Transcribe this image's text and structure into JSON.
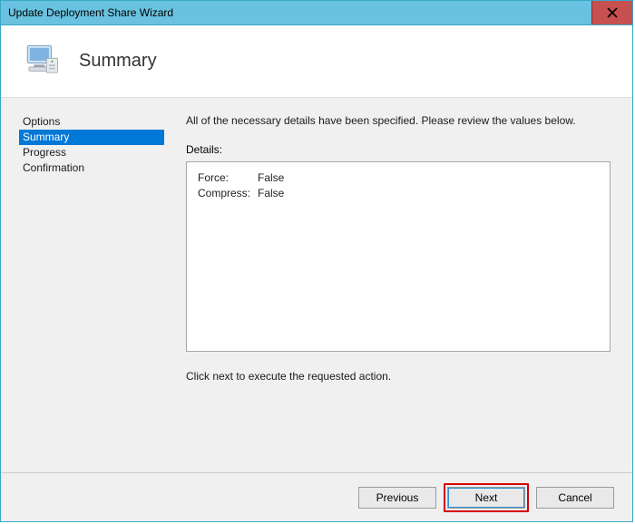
{
  "window": {
    "title": "Update Deployment Share Wizard"
  },
  "header": {
    "page_title": "Summary"
  },
  "sidebar": {
    "steps": {
      "0": {
        "label": "Options"
      },
      "1": {
        "label": "Summary"
      },
      "2": {
        "label": "Progress"
      },
      "3": {
        "label": "Confirmation"
      }
    },
    "selected_index": 1
  },
  "content": {
    "intro": "All of the necessary details have been specified.  Please review the values below.",
    "details_label": "Details:",
    "details": {
      "rows": {
        "0": {
          "key": "Force:",
          "value": "False"
        },
        "1": {
          "key": "Compress:",
          "value": "False"
        }
      }
    },
    "hint": "Click next to execute the requested action."
  },
  "footer": {
    "previous": "Previous",
    "next": "Next",
    "cancel": "Cancel"
  }
}
